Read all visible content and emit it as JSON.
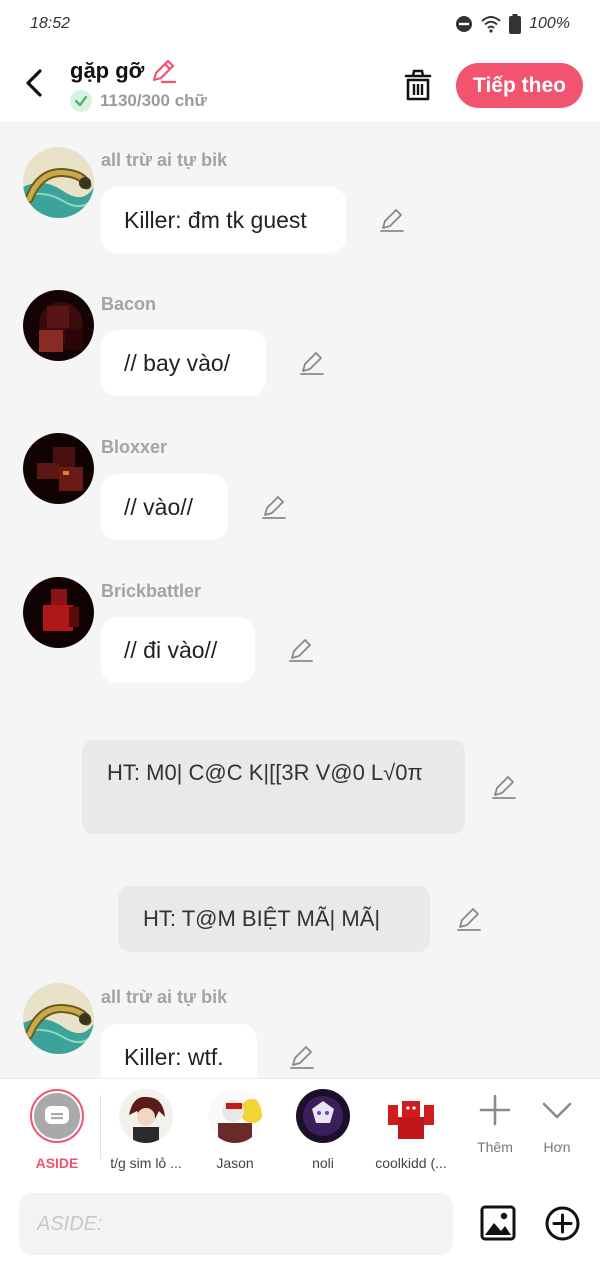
{
  "status_bar": {
    "time": "18:52",
    "battery": "100%"
  },
  "header": {
    "title": "gặp gỡ",
    "char_count": "1130/300 chữ",
    "next_button": "Tiếp theo"
  },
  "messages": [
    {
      "name": "all trừ ai tự bik",
      "text": "Killer: đm tk guest",
      "avatar": "sea-serpent"
    },
    {
      "name": "Bacon",
      "text": "// bay vào/",
      "avatar": "bacon"
    },
    {
      "name": "Bloxxer",
      "text": "// vào//",
      "avatar": "bloxxer"
    },
    {
      "name": "Brickbattler",
      "text": "// đi vào//",
      "avatar": "brickbattler"
    }
  ],
  "narrations": [
    {
      "text": "HT: M0| C@C K|[[3R V@0 L√0π"
    },
    {
      "text": "HT: T@M BIỆT MÃ| MÃ|"
    }
  ],
  "last_message": {
    "name": "all trừ ai tự bik",
    "text": "Killer: wtf."
  },
  "characters": [
    {
      "label": "ASIDE",
      "active": true
    },
    {
      "label": "t/g sim lỏ ..."
    },
    {
      "label": "Jason"
    },
    {
      "label": "noli"
    },
    {
      "label": "coolkidd (..."
    },
    {
      "label": "Thêm"
    },
    {
      "label": "Hơn"
    }
  ],
  "input": {
    "placeholder": "ASIDE:"
  },
  "colors": {
    "accent": "#f2546f",
    "background": "#f5f5f5",
    "bubble": "#ffffff",
    "narration": "#e9e9e9"
  }
}
